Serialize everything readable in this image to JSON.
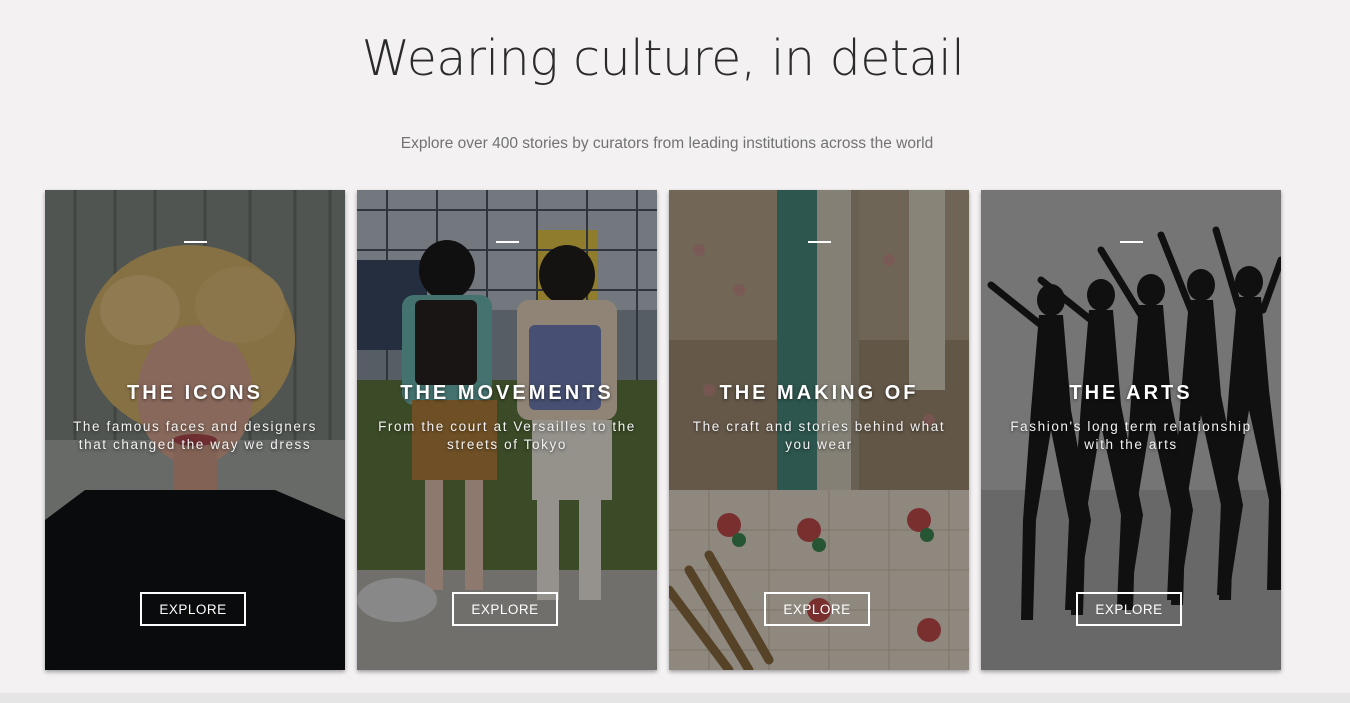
{
  "header": {
    "title": "Wearing culture, in detail",
    "subtitle": "Explore over 400 stories by curators from leading institutions across the world"
  },
  "cards": [
    {
      "title": "THE ICONS",
      "description": "The famous faces and designers that changed the way we dress",
      "button_label": "EXPLORE"
    },
    {
      "title": "THE MOVEMENTS",
      "description": "From the court at Versailles to the streets of Tokyo",
      "button_label": "EXPLORE"
    },
    {
      "title": "THE MAKING OF",
      "description": "The craft and stories behind what you wear",
      "button_label": "EXPLORE"
    },
    {
      "title": "THE ARTS",
      "description": "Fashion's long term relationship with the arts",
      "button_label": "EXPLORE"
    }
  ],
  "colors": {
    "page_background": "#f3f1f2",
    "title_text": "#2b2b2b",
    "subtitle_text": "#727272",
    "card_text": "#ffffff"
  }
}
